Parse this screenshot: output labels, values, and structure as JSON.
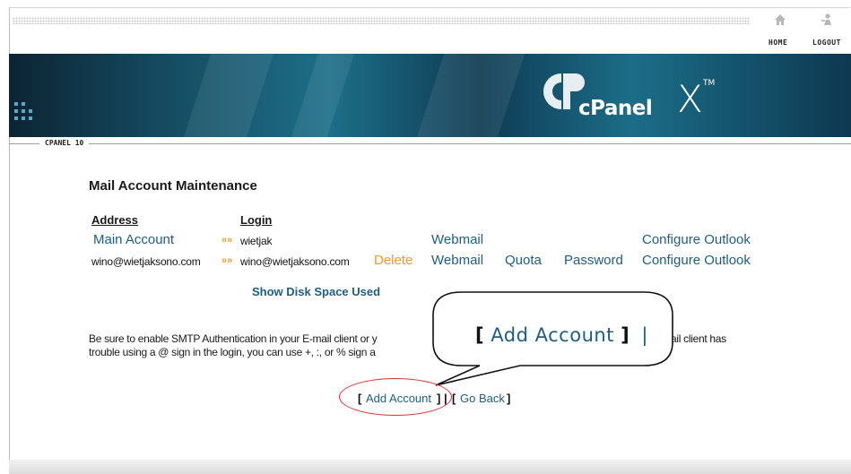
{
  "header": {
    "home_label": "HOME",
    "logout_label": "LOGOUT"
  },
  "banner": {
    "brand": "cPanel",
    "theme": "X",
    "trademark": "TM"
  },
  "section_label": "CPANEL 10",
  "page_title": "Mail Account Maintenance",
  "table": {
    "headers": {
      "address": "Address",
      "login": "Login"
    },
    "rows": [
      {
        "address": "Main Account",
        "arrows": "»»",
        "login": "wietjak",
        "webmail": "Webmail",
        "configure": "Configure Outlook"
      },
      {
        "address": "wino@wietjaksono.com",
        "arrows": "»»",
        "login": "wino@wietjaksono.com",
        "delete": "Delete",
        "webmail": "Webmail",
        "quota": "Quota",
        "password": "Password",
        "configure": "Configure Outlook"
      }
    ]
  },
  "disk_space_link": "Show Disk Space Used",
  "note": {
    "line1_start": "Be sure to enable SMTP Authentication in your E-mail client or y",
    "line1_end": "ail client has",
    "line2_start": "trouble using a @ sign in the login, you can use +, :, or % sign a"
  },
  "bottom_links": {
    "open_bracket": "[",
    "add_account": "Add Account",
    "sep": "] |",
    "open_bracket2": "[",
    "go_back": "Go Back",
    "close_bracket": "]"
  },
  "callout": {
    "open_bracket": "[",
    "label": "Add Account",
    "close_bracket": "]",
    "pipe": "|"
  },
  "colors": {
    "link": "#1f5d83",
    "accent_orange": "#f39a2a",
    "highlight_red": "#dd3333"
  }
}
